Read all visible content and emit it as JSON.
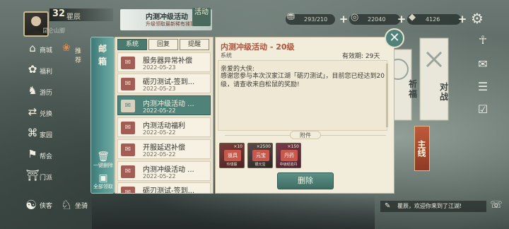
{
  "player": {
    "level": "32",
    "name": "瞿辰",
    "location": "昆仑山脚"
  },
  "event_banner": {
    "title": "内测冲级活动",
    "subtitle": "升级领取最新稀有揉瑞兽",
    "badge": "活动"
  },
  "resources": [
    {
      "icon": "treasure-icon",
      "value": "293/210"
    },
    {
      "icon": "coin-icon",
      "value": "22040"
    },
    {
      "icon": "ingot-icon",
      "value": "4126"
    }
  ],
  "left_menu": [
    {
      "icon": "shop-icon",
      "label": "商城"
    },
    {
      "icon": "gift-icon",
      "label": "福利"
    },
    {
      "icon": "travel-icon",
      "label": "游历"
    },
    {
      "icon": "exchange-icon",
      "label": "兑换"
    },
    {
      "icon": "home-icon",
      "label": "家园"
    },
    {
      "icon": "guild-icon",
      "label": "帮会"
    },
    {
      "icon": "sect-icon",
      "label": "门派"
    }
  ],
  "left_bottom": [
    {
      "icon": "retainer-icon",
      "label": "侠客"
    },
    {
      "icon": "mount-icon",
      "label": "坐骑"
    }
  ],
  "recommend_label": "推荐",
  "mailbox": {
    "label": "邮箱",
    "delete_read_label": "一键删除",
    "claim_all_label": "全部领取"
  },
  "tabs": [
    {
      "label": "系统",
      "active": true
    },
    {
      "label": "回复",
      "active": false
    },
    {
      "label": "提醒",
      "active": false
    }
  ],
  "mails": [
    {
      "title": "服务器异常补偿",
      "date": "2022-05-23",
      "selected": false
    },
    {
      "title": "砺刃测试-签到...",
      "date": "2022-05-23",
      "selected": false
    },
    {
      "title": "内测冲级活动 ...",
      "date": "2022-05-22",
      "selected": true
    },
    {
      "title": "内测活动福利",
      "date": "2022-05-22",
      "selected": false
    },
    {
      "title": "开服延迟补偿",
      "date": "2022-05-22",
      "selected": false
    },
    {
      "title": "内测冲级活动 ...",
      "date": "2022-05-22",
      "selected": false
    },
    {
      "title": "砺刃测试-签到...",
      "date": "",
      "selected": false
    }
  ],
  "detail": {
    "title": "内测冲级活动 - 20级",
    "sender": "系统",
    "expire": "有效期: 29天",
    "greeting": "亲爱的大侠:",
    "message": "感谢您参与本次汉家江湖「砺刃测试」，目前您已经达到20级，请查收来自松鼠的奖励!",
    "attachment_label": "附件",
    "delete_label": "删除"
  },
  "attachments": [
    {
      "count": "×10",
      "name": "玲珑骰",
      "tag": "道具"
    },
    {
      "count": "×2500",
      "name": "银元宝",
      "tag": "元宝"
    },
    {
      "count": "×150",
      "name": "中级经验丹",
      "tag": "丹药"
    }
  ],
  "banners": {
    "left": "祈福",
    "right": "对战"
  },
  "main_quest": "主线",
  "chat_text": "瞿辰，欢迎你来到了江湖!",
  "colors": {
    "accent": "#4f8278",
    "title": "#b0513a",
    "panel": "#f2ecda"
  }
}
